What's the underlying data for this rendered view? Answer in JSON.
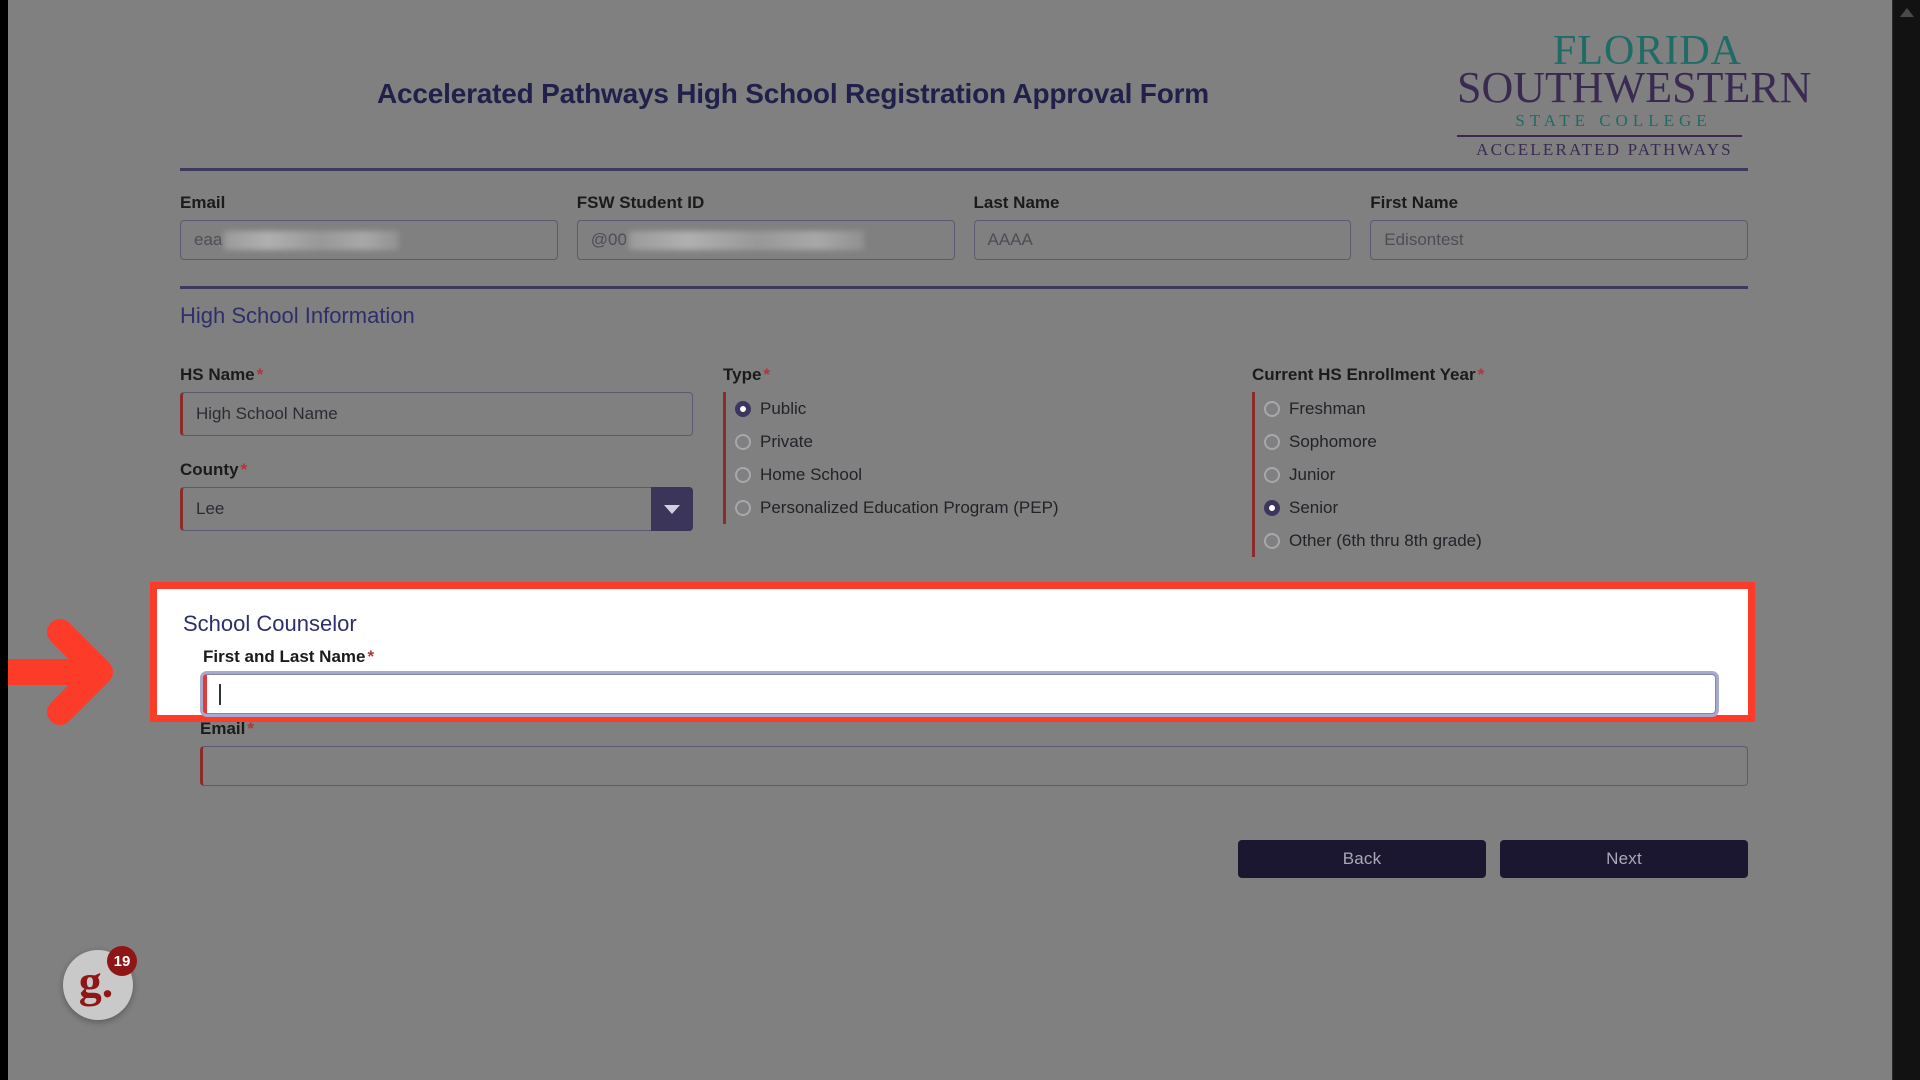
{
  "page": {
    "title": "Accelerated Pathways High School Registration Approval Form",
    "background_color": "#808080",
    "accent_color": "#2e2e6b",
    "required_marker": "*",
    "highlight_color": "#fc3b28"
  },
  "logo": {
    "line1": "FLORIDA",
    "line2": "SOUTHWESTERN",
    "line3": "STATE COLLEGE",
    "line4": "ACCELERATED PATHWAYS",
    "teal": "#1f6b66",
    "purple": "#3a2a52"
  },
  "student": {
    "email": {
      "label": "Email",
      "value": "eaa",
      "redacted": true
    },
    "fsw_student_id": {
      "label": "FSW Student ID",
      "value": "@00",
      "redacted": true
    },
    "last_name": {
      "label": "Last Name",
      "value": "AAAA"
    },
    "first_name": {
      "label": "First Name",
      "value": "Edisontest"
    }
  },
  "high_school": {
    "section_title": "High School Information",
    "hs_name": {
      "label": "HS Name",
      "value": "High School Name",
      "required": true
    },
    "county": {
      "label": "County",
      "value": "Lee",
      "required": true,
      "icon": "chevron-down-icon"
    },
    "type": {
      "label": "Type",
      "required": true,
      "selected": "Public",
      "options": [
        "Public",
        "Private",
        "Home School",
        "Personalized Education Program (PEP)"
      ]
    },
    "enrollment_year": {
      "label": "Current HS Enrollment Year",
      "required": true,
      "selected": "Senior",
      "options": [
        "Freshman",
        "Sophomore",
        "Junior",
        "Senior",
        "Other (6th thru 8th grade)"
      ]
    }
  },
  "counselor": {
    "section_title": "School Counselor",
    "name": {
      "label": "First and Last Name",
      "value": "",
      "required": true,
      "focused": true
    },
    "email": {
      "label": "Email",
      "value": "",
      "required": true
    }
  },
  "footer": {
    "back_label": "Back",
    "next_label": "Next"
  },
  "widget": {
    "glyph": "g.",
    "badge_count": "19"
  },
  "annotation": {
    "arrow": "red-right-arrow",
    "highlight_target": "counselor-name-field"
  }
}
